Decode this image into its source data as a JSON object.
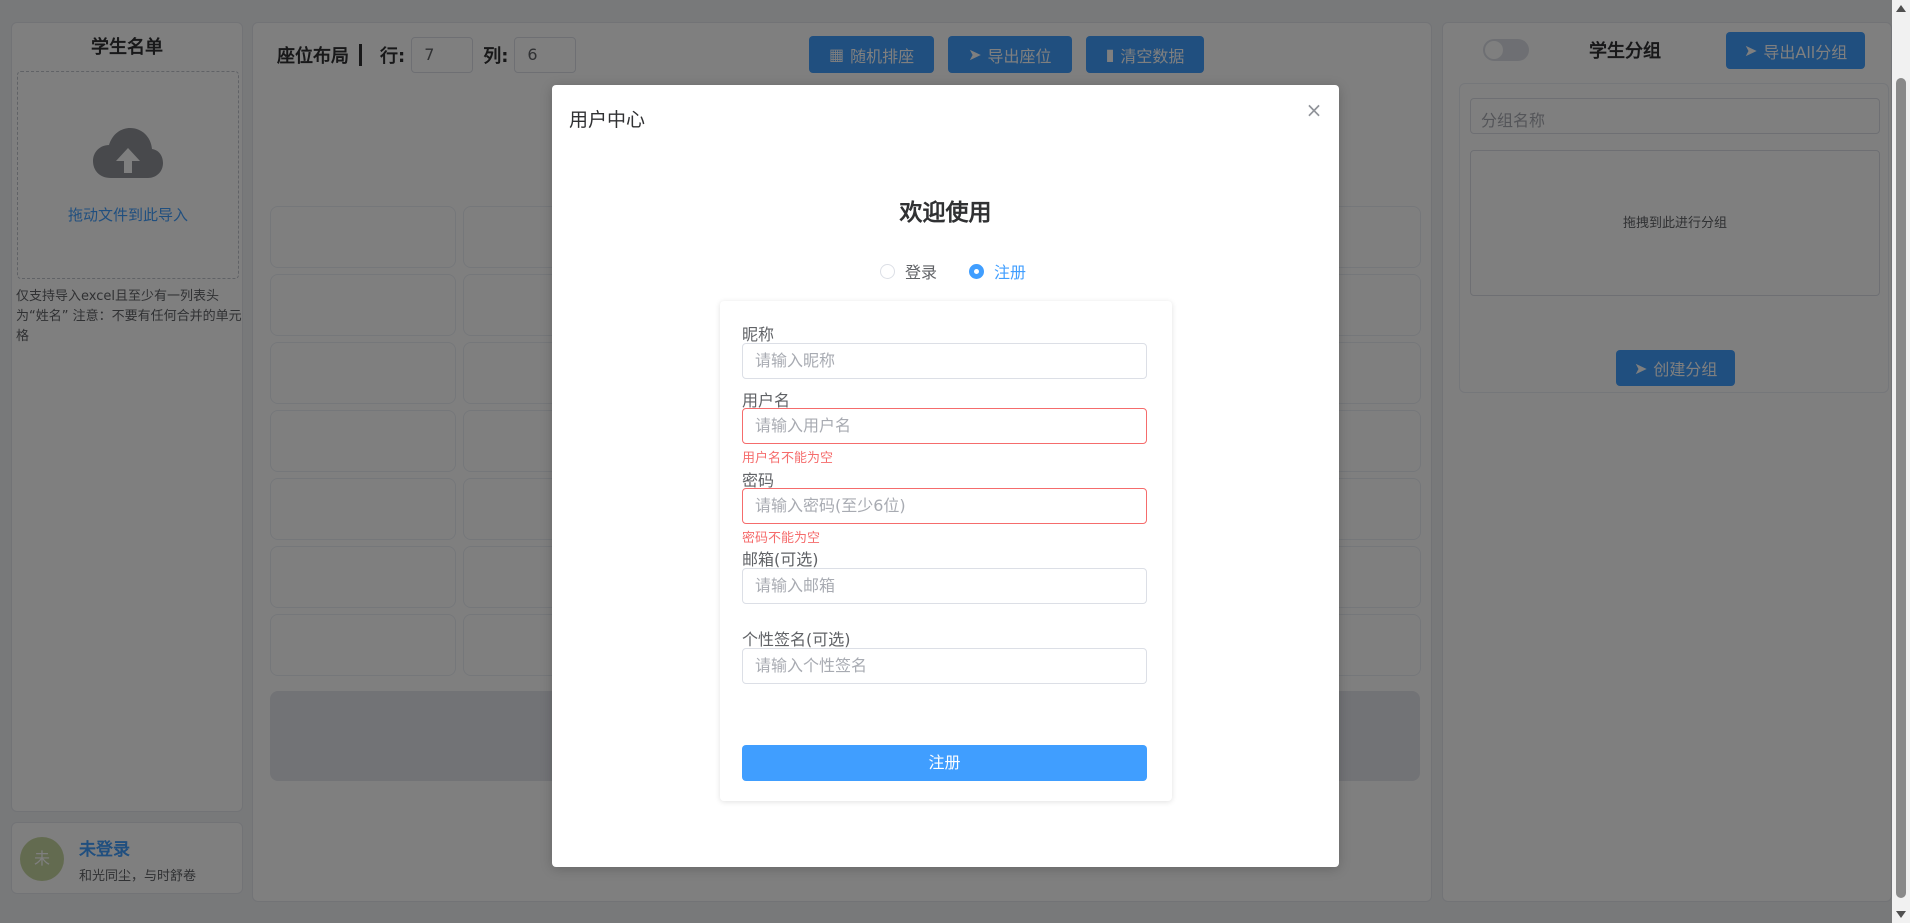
{
  "left": {
    "title": "学生名单",
    "upload_text": "拖动文件到此导入",
    "upload_tip": "仅支持导入excel且至少有一列表头为“姓名” 注意：不要有任何合并的单元格"
  },
  "user": {
    "avatar_char": "未",
    "name": "未登录",
    "sign": "和光同尘，与时舒卷"
  },
  "center": {
    "layout_label": "座位布局",
    "row_label": "行:",
    "row_value": "7",
    "col_label": "列:",
    "col_value": "6",
    "buttons": {
      "random": "随机排座",
      "export": "导出座位",
      "clear": "清空数据"
    }
  },
  "right": {
    "title": "学生分组",
    "export_all": "导出All分组",
    "group_placeholder": "分组名称",
    "drop_text": "拖拽到此进行分组",
    "create": "创建分组"
  },
  "dialog": {
    "title": "用户中心",
    "close": "×",
    "welcome": "欢迎使用",
    "modes": {
      "login": "登录",
      "register": "注册",
      "selected": "注册"
    },
    "fields": {
      "nickname": {
        "label": "昵称",
        "placeholder": "请输入昵称"
      },
      "username": {
        "label": "用户名",
        "placeholder": "请输入用户名",
        "error": "用户名不能为空"
      },
      "password": {
        "label": "密码",
        "placeholder": "请输入密码(至少6位)",
        "error": "密码不能为空"
      },
      "email": {
        "label": "邮箱(可选)",
        "placeholder": "请输入邮箱"
      },
      "signature": {
        "label": "个性签名(可选)",
        "placeholder": "请输入个性签名"
      }
    },
    "submit": "注册"
  },
  "colors": {
    "primary": "#409eff",
    "error": "#f56c6c",
    "overlay": "rgba(0,0,0,0.5)"
  }
}
